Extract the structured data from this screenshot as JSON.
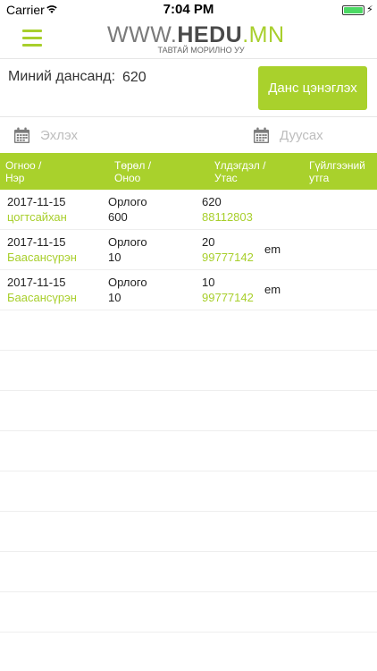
{
  "statusbar": {
    "carrier": "Carrier",
    "time": "7:04 PM",
    "icons": [
      "wifi-icon",
      "battery-icon",
      "charging-bolt-icon"
    ],
    "battery_level": 1.0
  },
  "header": {
    "logo": {
      "www": "WWW.",
      "hedu": "HEDU",
      "mn": ".MN",
      "subtitle": "ТАВТАЙ МОРИЛНО УУ"
    },
    "menu_icon": "hamburger-menu-icon"
  },
  "balance": {
    "label": "Миний дансанд:",
    "value": "620",
    "topup_button": "Данс цэнэглэх"
  },
  "date_filter": {
    "start_placeholder": "Эхлэх",
    "end_placeholder": "Дуусах",
    "start_value": "",
    "end_value": "",
    "icon": "calendar-icon"
  },
  "table": {
    "headers": [
      {
        "line1": "Огноо /",
        "line2": "Нэр"
      },
      {
        "line1": "Төрөл /",
        "line2": "Оноо"
      },
      {
        "line1": "Үлдэгдэл /",
        "line2": "Утас"
      },
      {
        "line1": "Гүйлгээний",
        "line2": "утга"
      }
    ],
    "rows": [
      {
        "date": "2017-11-15",
        "name": "цогтсайхан",
        "type": "Орлого",
        "score": "600",
        "balance": "620",
        "phone": "88112803",
        "desc": ""
      },
      {
        "date": "2017-11-15",
        "name": "Баасансүрэн",
        "type": "Орлого",
        "score": "10",
        "balance": "20",
        "phone": "99777142",
        "desc": "em"
      },
      {
        "date": "2017-11-15",
        "name": "Баасансүрэн",
        "type": "Орлого",
        "score": "10",
        "balance": "10",
        "phone": "99777142",
        "desc": "em"
      }
    ]
  },
  "colors": {
    "accent": "#a9d12c",
    "text": "#222222",
    "placeholder": "#bdbdbd",
    "divider": "#eeeeee"
  }
}
